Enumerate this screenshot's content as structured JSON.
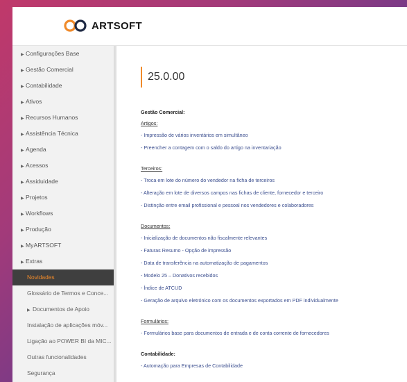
{
  "brand": {
    "name": "ARTSOFT"
  },
  "colors": {
    "accent": "#f08a2a",
    "active_bg": "#3f3f3f",
    "link": "#3c4f8f"
  },
  "sidebar": {
    "items": [
      {
        "label": "Configurações Base"
      },
      {
        "label": "Gestão Comercial"
      },
      {
        "label": "Contabilidade"
      },
      {
        "label": "Ativos"
      },
      {
        "label": "Recursos Humanos"
      },
      {
        "label": "Assistência Técnica"
      },
      {
        "label": "Agenda"
      },
      {
        "label": "Acessos"
      },
      {
        "label": "Assiduidade"
      },
      {
        "label": "Projetos"
      },
      {
        "label": "Workflows"
      },
      {
        "label": "Produção"
      },
      {
        "label": "MyARTSOFT"
      },
      {
        "label": "Extras"
      }
    ],
    "sub_items": [
      {
        "label": "Novidades"
      },
      {
        "label": "Glossário de Termos e Conce..."
      },
      {
        "label": "Documentos de Apoio"
      },
      {
        "label": "Instalação de aplicações móv..."
      },
      {
        "label": "Ligação ao POWER BI da MIC..."
      },
      {
        "label": "Outras funcionalidades"
      },
      {
        "label": "Segurança"
      }
    ]
  },
  "main": {
    "version": "25.0.00",
    "sections": [
      {
        "title": "Gestão Comercial:",
        "groups": [
          {
            "title": "Artigos:",
            "items": [
              "- Impressão de vários inventários em simultâneo",
              "- Preencher a contagem com o saldo do artigo na inventariação"
            ]
          },
          {
            "title": "Terceiros:",
            "items": [
              "- Troca em lote do número do vendedor na ficha de terceiros",
              "- Alteração em lote de diversos campos nas fichas de cliente, fornecedor e terceiro",
              "- Distinção entre email profissional e pessoal nos vendedores e colaboradores"
            ]
          },
          {
            "title": "Documentos:",
            "items": [
              "- Inicialização de documentos não fiscalmente relevantes",
              "- Faturas Resumo - Opção de impressão",
              "- Data de transferência na automatização de pagamentos",
              "- Modelo 25 – Donativos recebidos",
              "- Índice de ATCUD",
              "- Geração de arquivo eletrónico com os documentos exportados em PDF individualmente"
            ]
          },
          {
            "title": "Formulários:",
            "items": [
              "- Formulários base para documentos de entrada e de conta corrente de fornecedores"
            ]
          }
        ]
      },
      {
        "title": "Contabilidade:",
        "items": [
          "- Automação para Empresas de Contabilidade"
        ]
      }
    ]
  }
}
